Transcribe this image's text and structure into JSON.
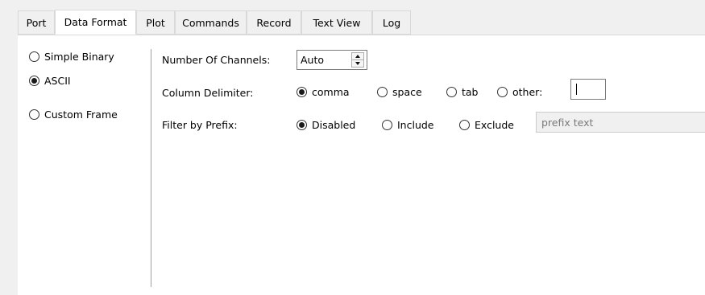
{
  "tabs": [
    {
      "label": "Port",
      "active": false
    },
    {
      "label": "Data Format",
      "active": true
    },
    {
      "label": "Plot",
      "active": false
    },
    {
      "label": "Commands",
      "active": false
    },
    {
      "label": "Record",
      "active": false
    },
    {
      "label": "Text View",
      "active": false
    },
    {
      "label": "Log",
      "active": false
    }
  ],
  "format_options": [
    {
      "label": "Simple Binary",
      "checked": false
    },
    {
      "label": "ASCII",
      "checked": true
    },
    {
      "label": "Custom Frame",
      "checked": false
    }
  ],
  "channels": {
    "label": "Number Of Channels:",
    "value": "Auto"
  },
  "delimiter": {
    "label": "Column Delimiter:",
    "options": [
      {
        "label": "comma",
        "checked": true
      },
      {
        "label": "space",
        "checked": false
      },
      {
        "label": "tab",
        "checked": false
      },
      {
        "label": "other:",
        "checked": false
      }
    ],
    "other_value": ""
  },
  "prefix": {
    "label": "Filter by Prefix:",
    "options": [
      {
        "label": "Disabled",
        "checked": true
      },
      {
        "label": "Include",
        "checked": false
      },
      {
        "label": "Exclude",
        "checked": false
      }
    ],
    "placeholder": "prefix text"
  }
}
